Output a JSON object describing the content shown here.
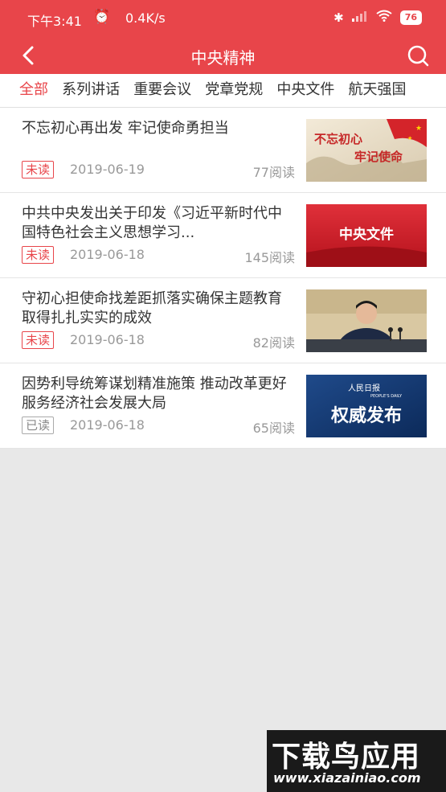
{
  "status_bar": {
    "time": "下午3:41",
    "speed": "0.4K/s",
    "battery": "76"
  },
  "navbar": {
    "title": "中央精神"
  },
  "tabs": [
    {
      "label": "全部",
      "active": true
    },
    {
      "label": "系列讲话",
      "active": false
    },
    {
      "label": "重要会议",
      "active": false
    },
    {
      "label": "党章党规",
      "active": false
    },
    {
      "label": "中央文件",
      "active": false
    },
    {
      "label": "航天强国",
      "active": false
    }
  ],
  "articles": [
    {
      "title": "不忘初心再出发 牢记使命勇担当",
      "status": "未读",
      "date": "2019-06-19",
      "views": "77阅读",
      "thumb_text": [
        "不忘初心",
        "牢记使命"
      ]
    },
    {
      "title": "中共中央发出关于印发《习近平新时代中国特色社会主义思想学习...",
      "status": "未读",
      "date": "2019-06-18",
      "views": "145阅读",
      "thumb_text": [
        "中央文件"
      ]
    },
    {
      "title": "守初心担使命找差距抓落实确保主题教育取得扎扎实实的成效",
      "status": "未读",
      "date": "2019-06-18",
      "views": "82阅读",
      "thumb_text": []
    },
    {
      "title": "因势利导统筹谋划精准施策 推动改革更好服务经济社会发展大局",
      "status": "已读",
      "date": "2019-06-18",
      "views": "65阅读",
      "thumb_text": [
        "权威发布",
        "人民日报",
        "PEOPLE'S DAILY"
      ]
    }
  ],
  "watermark": {
    "title": "下载鸟应用",
    "url": "www.xiazainiao.com"
  },
  "colors": {
    "accent": "#e8454a"
  }
}
